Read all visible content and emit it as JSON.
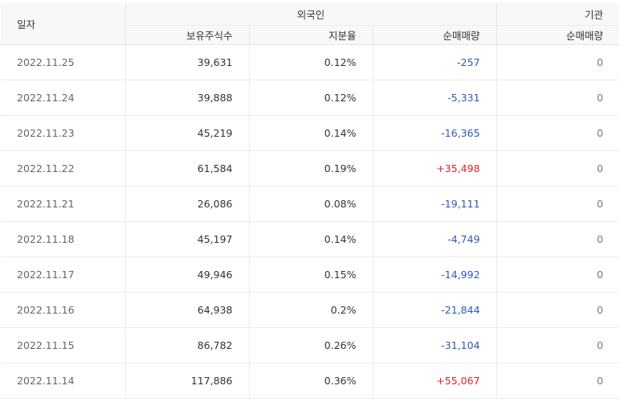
{
  "header": {
    "date_label": "일자",
    "foreign_group": "외국인",
    "inst_group": "기관",
    "holdings_label": "보유주식수",
    "ratio_label": "지분율",
    "foreign_net_label": "순매매량",
    "inst_net_label": "순매매량"
  },
  "rows": [
    {
      "date": "2022.11.25",
      "holdings": "39,631",
      "ratio": "0.12%",
      "foreign_net": "-257",
      "inst_net": "0"
    },
    {
      "date": "2022.11.24",
      "holdings": "39,888",
      "ratio": "0.12%",
      "foreign_net": "-5,331",
      "inst_net": "0"
    },
    {
      "date": "2022.11.23",
      "holdings": "45,219",
      "ratio": "0.14%",
      "foreign_net": "-16,365",
      "inst_net": "0"
    },
    {
      "date": "2022.11.22",
      "holdings": "61,584",
      "ratio": "0.19%",
      "foreign_net": "+35,498",
      "inst_net": "0"
    },
    {
      "date": "2022.11.21",
      "holdings": "26,086",
      "ratio": "0.08%",
      "foreign_net": "-19,111",
      "inst_net": "0"
    },
    {
      "date": "2022.11.18",
      "holdings": "45,197",
      "ratio": "0.14%",
      "foreign_net": "-4,749",
      "inst_net": "0"
    },
    {
      "date": "2022.11.17",
      "holdings": "49,946",
      "ratio": "0.15%",
      "foreign_net": "-14,992",
      "inst_net": "0"
    },
    {
      "date": "2022.11.16",
      "holdings": "64,938",
      "ratio": "0.2%",
      "foreign_net": "-21,844",
      "inst_net": "0"
    },
    {
      "date": "2022.11.15",
      "holdings": "86,782",
      "ratio": "0.26%",
      "foreign_net": "-31,104",
      "inst_net": "0"
    },
    {
      "date": "2022.11.14",
      "holdings": "117,886",
      "ratio": "0.36%",
      "foreign_net": "+55,067",
      "inst_net": "0"
    }
  ],
  "colors": {
    "negative": "#2e59b5",
    "positive": "#e0212e",
    "header_bg": "#f8f8f8"
  }
}
